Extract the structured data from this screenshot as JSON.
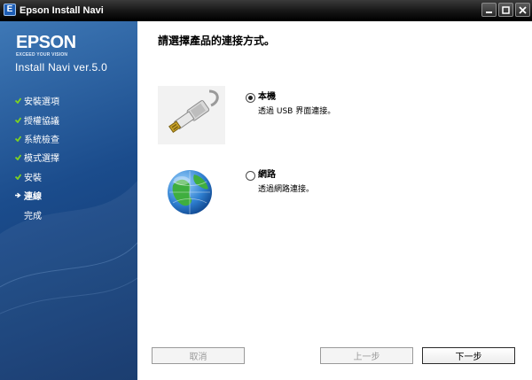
{
  "window": {
    "title": "Epson Install Navi",
    "icon_letter": "E"
  },
  "sidebar": {
    "brand": "EPSON",
    "tagline": "EXCEED YOUR VISION",
    "product": "Install Navi ver.5.0",
    "steps": [
      {
        "label": "安裝選項",
        "state": "done"
      },
      {
        "label": "授權協議",
        "state": "done"
      },
      {
        "label": "系統檢查",
        "state": "done"
      },
      {
        "label": "模式選擇",
        "state": "done"
      },
      {
        "label": "安裝",
        "state": "done"
      },
      {
        "label": "連線",
        "state": "current"
      },
      {
        "label": "完成",
        "state": "pending"
      }
    ]
  },
  "main": {
    "heading": "請選擇產品的連接方式。",
    "options": [
      {
        "title": "本機",
        "description": "透過 USB 界面連接。",
        "selected": true,
        "icon": "usb-cable-icon"
      },
      {
        "title": "網路",
        "description": "透過網路連接。",
        "selected": false,
        "icon": "globe-network-icon"
      }
    ]
  },
  "buttons": {
    "cancel": "取消",
    "back": "上一步",
    "next": "下一步"
  },
  "colors": {
    "sidebar_top": "#3e78b6",
    "sidebar_bottom": "#0d3268",
    "check_green": "#7ed321",
    "titlebar": "#161616"
  }
}
